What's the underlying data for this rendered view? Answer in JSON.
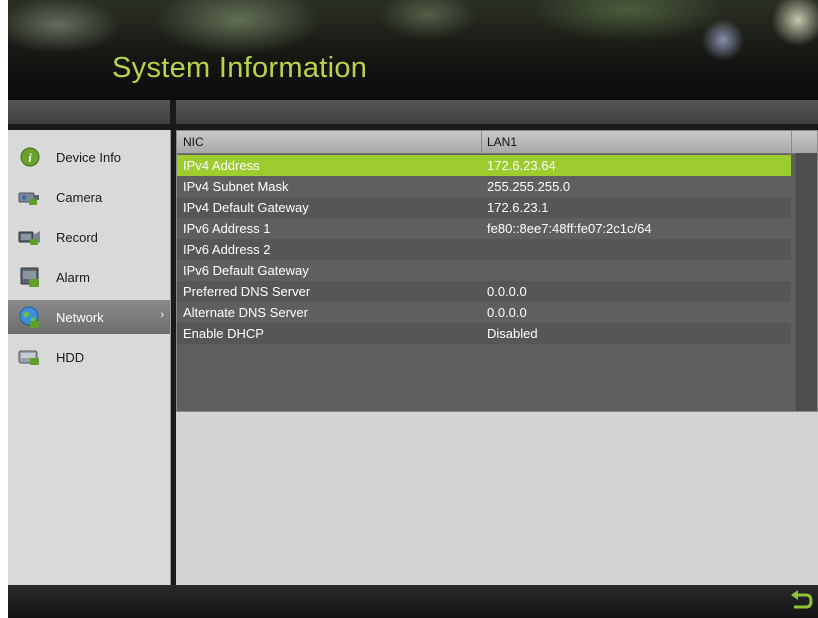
{
  "title": "System Information",
  "sidebar": {
    "items": [
      {
        "label": "Device Info",
        "icon": "info-icon",
        "active": false
      },
      {
        "label": "Camera",
        "icon": "camera-icon",
        "active": false
      },
      {
        "label": "Record",
        "icon": "record-icon",
        "active": false
      },
      {
        "label": "Alarm",
        "icon": "alarm-icon",
        "active": false
      },
      {
        "label": "Network",
        "icon": "network-icon",
        "active": true
      },
      {
        "label": "HDD",
        "icon": "hdd-icon",
        "active": false
      }
    ],
    "active_chevron": "›"
  },
  "table": {
    "columns": [
      "NIC",
      "LAN1"
    ],
    "rows": [
      {
        "name": "IPv4 Address",
        "value": "172.6.23.64"
      },
      {
        "name": "IPv4 Subnet Mask",
        "value": "255.255.255.0"
      },
      {
        "name": "IPv4 Default Gateway",
        "value": "172.6.23.1"
      },
      {
        "name": "IPv6 Address 1",
        "value": "fe80::8ee7:48ff:fe07:2c1c/64"
      },
      {
        "name": "IPv6 Address 2",
        "value": ""
      },
      {
        "name": "IPv6 Default Gateway",
        "value": ""
      },
      {
        "name": "Preferred DNS Server",
        "value": "0.0.0.0"
      },
      {
        "name": "Alternate DNS Server",
        "value": "0.0.0.0"
      },
      {
        "name": "Enable DHCP",
        "value": "Disabled"
      }
    ],
    "selected_row": 0
  },
  "footer": {
    "back_icon": "return-arrow-icon"
  },
  "colors": {
    "accent": "#9ccc2e",
    "title": "#b8d44a"
  }
}
